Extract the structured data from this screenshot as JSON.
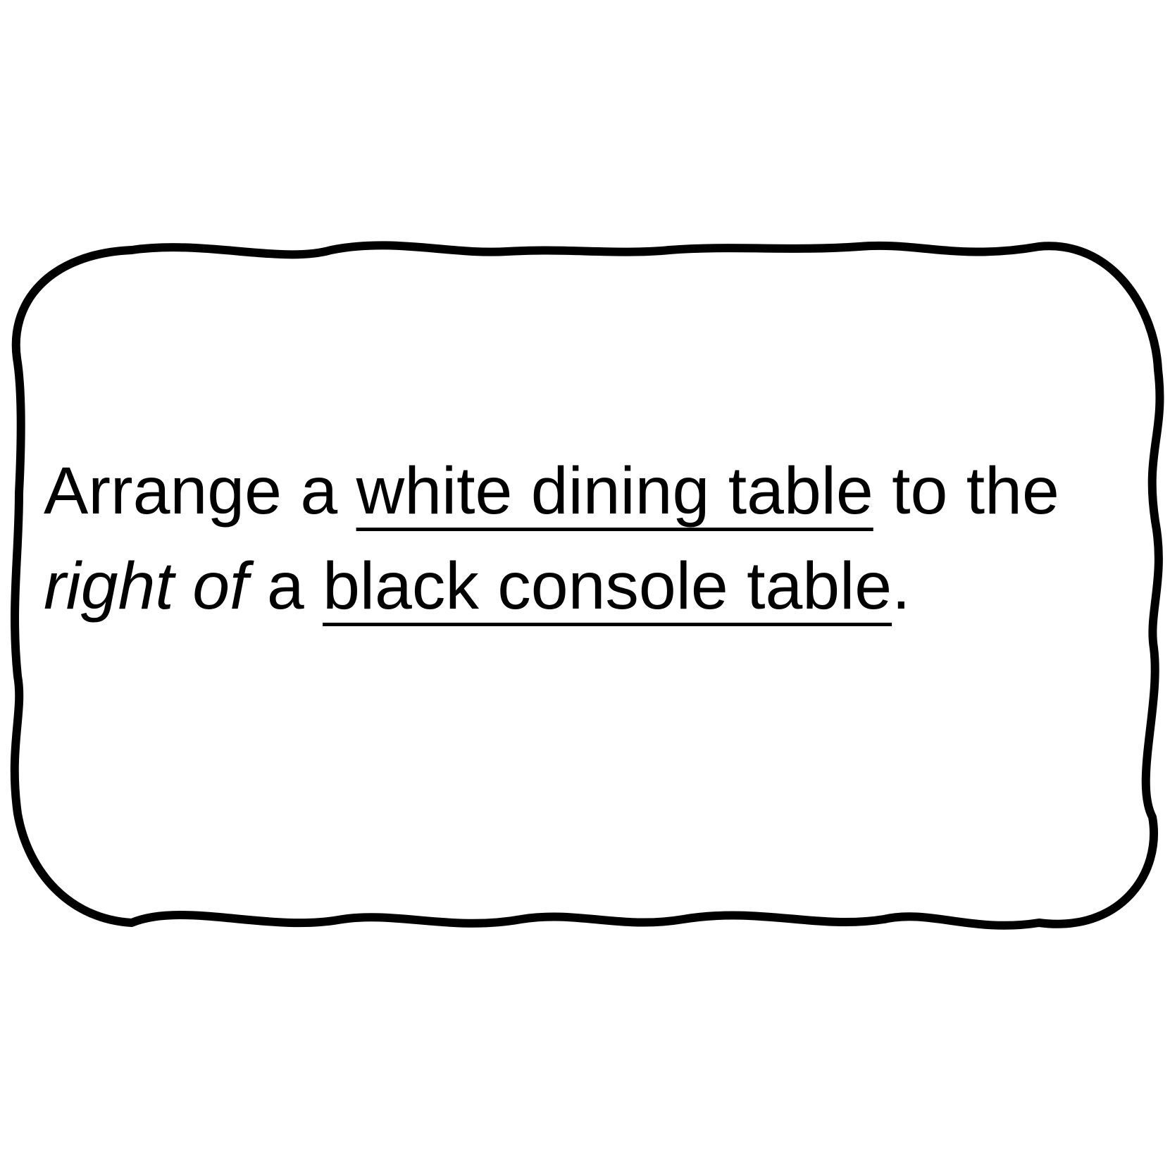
{
  "caption": {
    "text_1": "Arrange a ",
    "object_1": "white dining table",
    "text_2": " to the ",
    "relation": "right of",
    "text_3": " a ",
    "object_2": "black console table",
    "text_4": "."
  },
  "colors": {
    "background": "#ffffff",
    "ink": "#000000"
  }
}
